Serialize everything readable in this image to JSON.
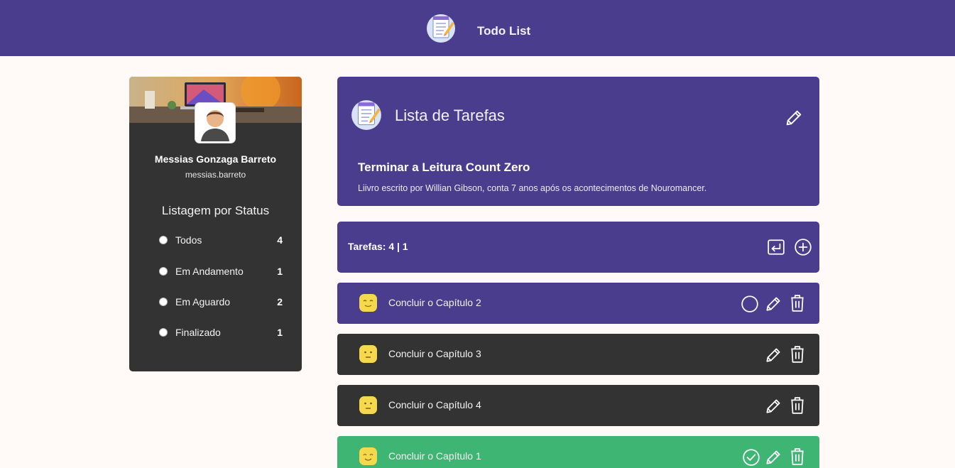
{
  "header": {
    "app_title": "Todo List",
    "logo_icon": "notepad-checklist-icon"
  },
  "sidebar": {
    "user_name": "Messias Gonzaga Barreto",
    "user_handle": "messias.barreto",
    "status_heading": "Listagem por Status",
    "statuses": [
      {
        "label": "Todos",
        "count": "4"
      },
      {
        "label": "Em Andamento",
        "count": "1"
      },
      {
        "label": "Em Aguardo",
        "count": "2"
      },
      {
        "label": "Finalizado",
        "count": "1"
      }
    ]
  },
  "list": {
    "title": "Lista de Tarefas",
    "description_title": "Terminar a Leitura Count Zero",
    "description_text": "Liivro escrito por Willian Gibson, conta 7 anos após os acontecimentos de Nouromancer."
  },
  "counter": {
    "text": "Tarefas: 4 | 1"
  },
  "tasks": [
    {
      "label": "Concluir o Capítulo 2",
      "status": "em-andamento",
      "color": "#4a3d8e",
      "emoji_icon": "smiling-face-icon"
    },
    {
      "label": "Concluir o Capítulo 3",
      "status": "em-aguardo",
      "color": "#333333",
      "emoji_icon": "neutral-face-icon"
    },
    {
      "label": "Concluir o Capítulo 4",
      "status": "em-aguardo",
      "color": "#333333",
      "emoji_icon": "neutral-face-icon"
    },
    {
      "label": "Concluir o Capítulo 1",
      "status": "finalizado",
      "color": "#3fb573",
      "emoji_icon": "happy-face-icon"
    }
  ],
  "colors": {
    "primary": "#4a3d8e",
    "dark": "#333333",
    "success": "#3fb573",
    "background": "#fffaf8",
    "emoji": "#f6d84c"
  }
}
